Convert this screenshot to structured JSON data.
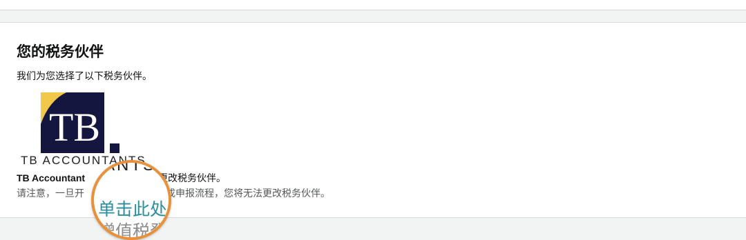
{
  "section": {
    "title": "您的税务伙伴",
    "description": "我们为您选择了以下税务伙伴。"
  },
  "partner": {
    "logo_monogram": "TB",
    "logo_text": "TB ACCOUNTANTS",
    "name": "TB Accountant",
    "change_suffix": "果您想更改税务伙伴。"
  },
  "note": {
    "prefix": "请注意，一旦开",
    "suffix": "成申报流程，您将无法更改税务伙伴。"
  },
  "magnifier": {
    "logo_fragment": "ANTS",
    "link_label": "单击此处",
    "vat_fragment": "增值税登"
  },
  "colors": {
    "logo_navy": "#14163f",
    "logo_gold": "#f2c84b",
    "link": "#2b8ea0",
    "magnifier_ring": "#e8913a"
  }
}
